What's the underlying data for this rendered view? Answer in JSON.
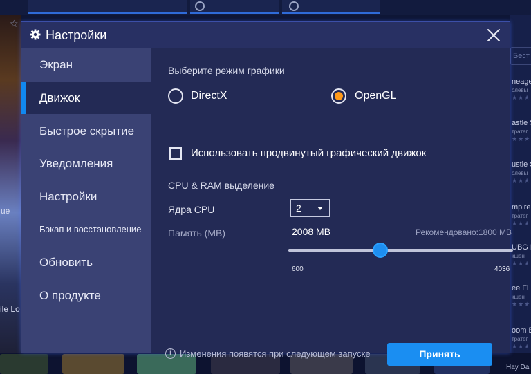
{
  "background": {
    "left_texts": [
      "ue",
      "ile Lo"
    ],
    "right_search_placeholder": "Бест",
    "right_items": [
      {
        "title": "neage",
        "sub": "олевы"
      },
      {
        "title": "astle S",
        "sub": "тратег"
      },
      {
        "title": "ustle S",
        "sub": "олевы"
      },
      {
        "title": "mpire",
        "sub": "тратег"
      },
      {
        "title": "UBG M",
        "sub": "кшен"
      },
      {
        "title": "ee Fi",
        "sub": "кшен"
      },
      {
        "title": "oom B",
        "sub": "тратег"
      }
    ],
    "bottom_right_text": "Hay Da"
  },
  "dialog": {
    "title": "Настройки",
    "icons": {
      "title": "gear-icon",
      "close": "close-icon",
      "info": "info-icon"
    },
    "sidebar": [
      {
        "label": "Экран",
        "active": false
      },
      {
        "label": "Движок",
        "active": true
      },
      {
        "label": "Быстрое скрытие",
        "active": false
      },
      {
        "label": "Уведомления",
        "active": false
      },
      {
        "label": "Настройки",
        "active": false
      },
      {
        "label": "Бэкап и восстановление",
        "active": false
      },
      {
        "label": "Обновить",
        "active": false
      },
      {
        "label": "О продукте",
        "active": false
      }
    ],
    "engine": {
      "graphics_mode_label": "Выберите режим графики",
      "options": [
        {
          "label": "DirectX",
          "checked": false
        },
        {
          "label": "OpenGL",
          "checked": true
        }
      ],
      "advanced_checkbox": {
        "label": "Использовать продвинутый графический движок",
        "checked": false
      },
      "alloc_title": "CPU & RAM выделение",
      "cpu_label": "Ядра CPU",
      "cpu_value": "2",
      "memory_label": "Память (MB)",
      "memory_value": "2008 MB",
      "memory_amount": 2008,
      "recommended": "Рекомендовано:1800 MB",
      "slider_min": "600",
      "slider_max": "4036",
      "restart_note": "Изменения появятся при следующем запуске",
      "apply_label": "Принять"
    },
    "colors": {
      "accent": "#1a8ef2",
      "radio_checked": "#ff9a1a",
      "dialog_bg": "#232a55",
      "sidebar_bg": "#3a4274"
    }
  }
}
